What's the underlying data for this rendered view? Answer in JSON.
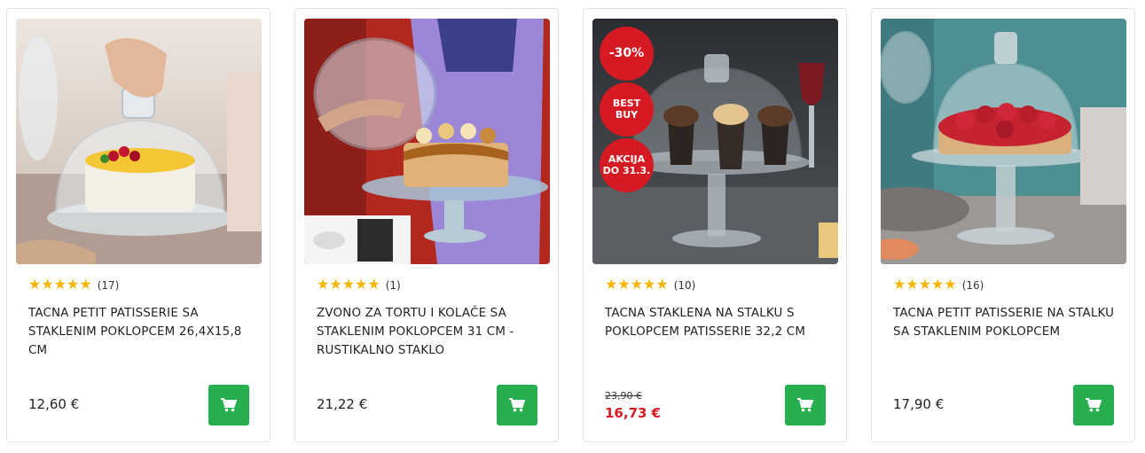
{
  "products": [
    {
      "title": "TACNA PETIT PATISSERIE SA STAKLENIM POKLOPCEM 26,4x15,8 CM",
      "rating": 5,
      "stars": "★★★★★",
      "reviews": "(17)",
      "price": "12,60 €",
      "image_icon": "cake-dome-photo"
    },
    {
      "title": "ZVONO ZA TORTU I KOLAČE SA STAKLENIM POKLOPCEM 31 CM - RUSTIKALNO STAKLO",
      "rating": 5,
      "stars": "★★★★★",
      "reviews": "(1)",
      "price": "21,22 €",
      "image_icon": "cake-stand-photo"
    },
    {
      "title": "TACNA STAKLENA NA STALKU S POKLOPCEM PATISSERIE 32,2 CM",
      "rating": 5,
      "stars": "★★★★★",
      "reviews": "(10)",
      "old_price": "23,90 €",
      "sale_price": "16,73 €",
      "badges": [
        "-30%",
        "BEST\nBUY",
        "AKCIJA\nDO 31.3."
      ],
      "image_icon": "muffin-stand-photo"
    },
    {
      "title": "TACNA PETIT PATISSERIE NA STALKU SA STAKLENIM POKLOPCEM",
      "rating": 5,
      "stars": "★★★★★",
      "reviews": "(16)",
      "price": "17,90 €",
      "image_icon": "tart-stand-photo"
    }
  ],
  "cart_icon": "shopping-cart-icon",
  "colors": {
    "accent_green": "#27ae4f",
    "sale_red": "#d61a23",
    "star_yellow": "#f5b400",
    "border": "#e2e2e2"
  }
}
